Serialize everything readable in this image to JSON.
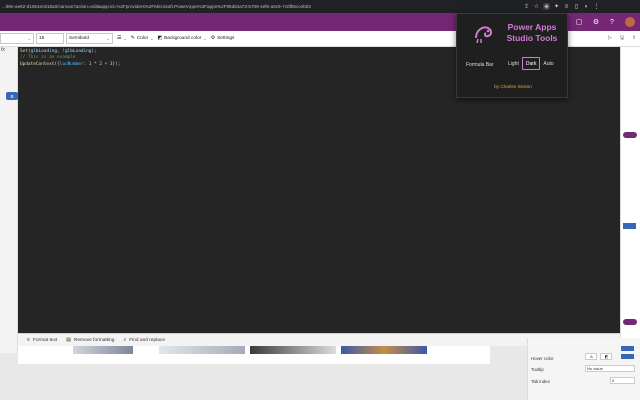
{
  "browser": {
    "url": "...98e-ae82-d1054ec816a0/canvas?action=edit&app-id=%2Fproviders%2FMicrosoft.PowerApps%2Fapps%2F95d64a73-5709-4ef6-a5c9-7c0fb5cceb63"
  },
  "toolbar": {
    "font_size": "15",
    "font_weight": "Semibold",
    "color_label": "Color",
    "bg_color_label": "Background color",
    "settings_label": "Settings",
    "fx_label": "fx"
  },
  "editor": {
    "line1": {
      "fn": "Set",
      "open": "(",
      "var": "glbLoading",
      "mid": ", ",
      "arg": "!glbLoading",
      "close": ");"
    },
    "line2": {
      "comment": "// This is an example"
    },
    "line3": {
      "fn": "UpdateContext",
      "open": "({",
      "id": "locNumber",
      "rest": ": 1 * 2 + 3});"
    }
  },
  "editor_footer": {
    "format_text": "Format text",
    "remove_formatting": "Remove formatting",
    "find_replace": "Find and replace"
  },
  "popup": {
    "title_line1": "Power Apps",
    "title_line2": "Studio Tools",
    "formula_bar_label": "Formula Bar",
    "options": [
      "Light",
      "Dark",
      "Auto"
    ],
    "selected": "Dark",
    "credit": "by Charles Sexton"
  },
  "right_panel": {
    "hover_color_label": "Hover color",
    "tooltip_label": "Tooltip",
    "tooltip_value": "No value",
    "tab_index_label": "Tab index",
    "tab_index_value": "0",
    "accent": "#742774"
  },
  "left_panel": {
    "button_label": "B"
  }
}
